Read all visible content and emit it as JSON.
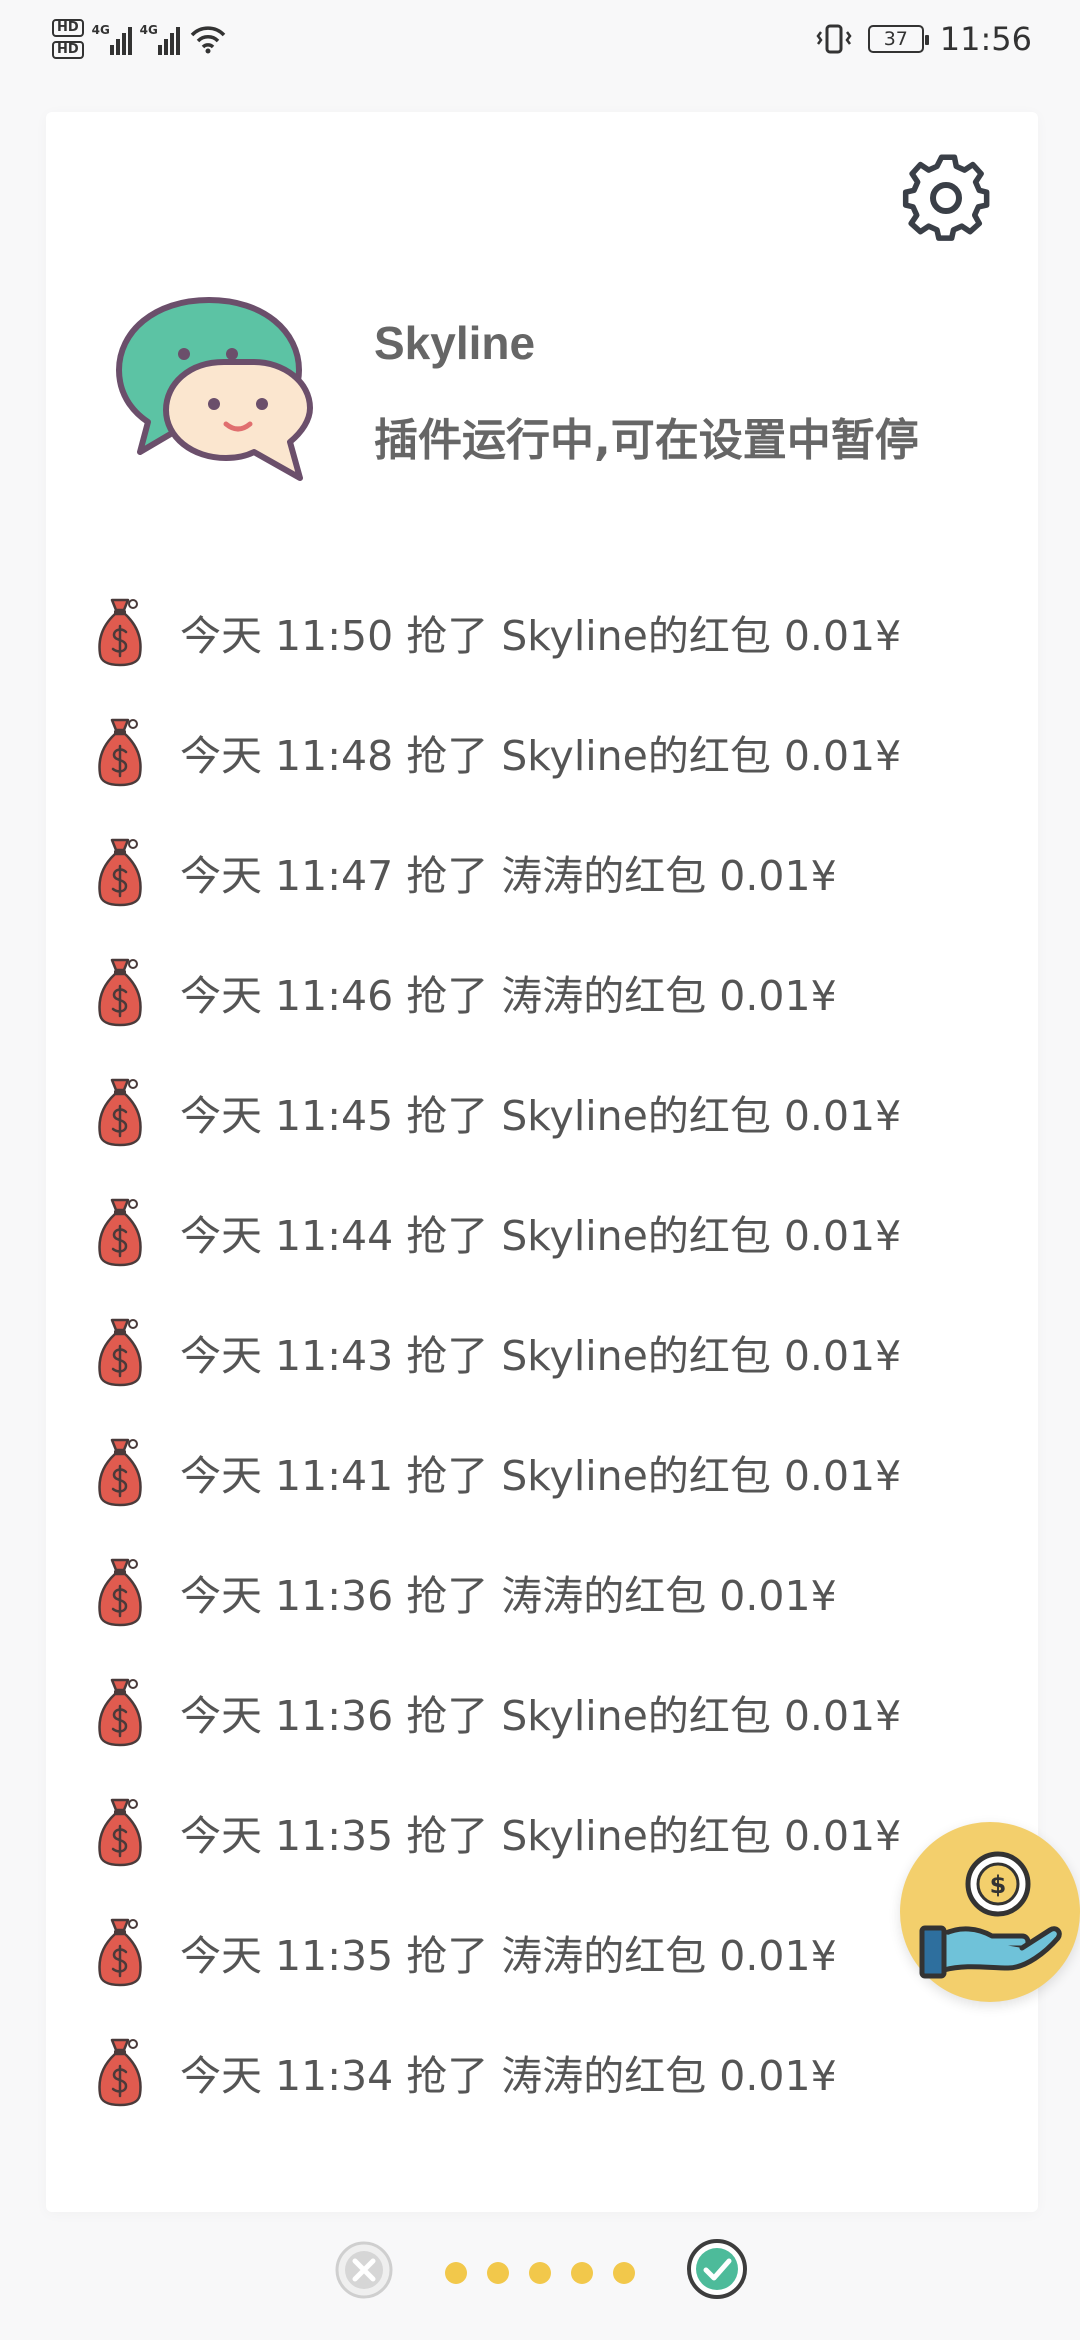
{
  "status_bar": {
    "hd_label": "HD",
    "net_1": "4G",
    "net_2": "4G",
    "battery": "37",
    "time": "11:56"
  },
  "header": {
    "title": "Skyline",
    "subtitle": "插件运行中,可在设置中暂停"
  },
  "records": [
    {
      "text": "今天 11:50 抢了 Skyline的红包 0.01¥"
    },
    {
      "text": "今天 11:48 抢了 Skyline的红包 0.01¥"
    },
    {
      "text": "今天 11:47 抢了 涛涛的红包 0.01¥"
    },
    {
      "text": "今天 11:46 抢了 涛涛的红包 0.01¥"
    },
    {
      "text": "今天 11:45 抢了 Skyline的红包 0.01¥"
    },
    {
      "text": "今天 11:44 抢了 Skyline的红包 0.01¥"
    },
    {
      "text": "今天 11:43 抢了 Skyline的红包 0.01¥"
    },
    {
      "text": "今天 11:41 抢了 Skyline的红包 0.01¥"
    },
    {
      "text": "今天 11:36 抢了 涛涛的红包 0.01¥"
    },
    {
      "text": "今天 11:36 抢了 Skyline的红包 0.01¥"
    },
    {
      "text": "今天 11:35 抢了 Skyline的红包 0.01¥"
    },
    {
      "text": "今天 11:35 抢了 涛涛的红包 0.01¥"
    },
    {
      "text": "今天 11:34 抢了 涛涛的红包 0.01¥"
    },
    {
      "text": ""
    }
  ],
  "colors": {
    "bag_red": "#e05b4f",
    "fab_yellow": "#f3cf6c",
    "chat_green": "#5cc3a4",
    "chat_cream": "#fbe6cf",
    "check_green": "#4dbb9a"
  },
  "icons": {
    "settings": "gear-icon",
    "logo": "chat-bubbles-icon",
    "record": "money-bag-icon",
    "fab": "coin-hand-icon",
    "cancel": "close-circle-icon",
    "confirm": "check-circle-icon"
  },
  "pager": {
    "dots": 5
  }
}
